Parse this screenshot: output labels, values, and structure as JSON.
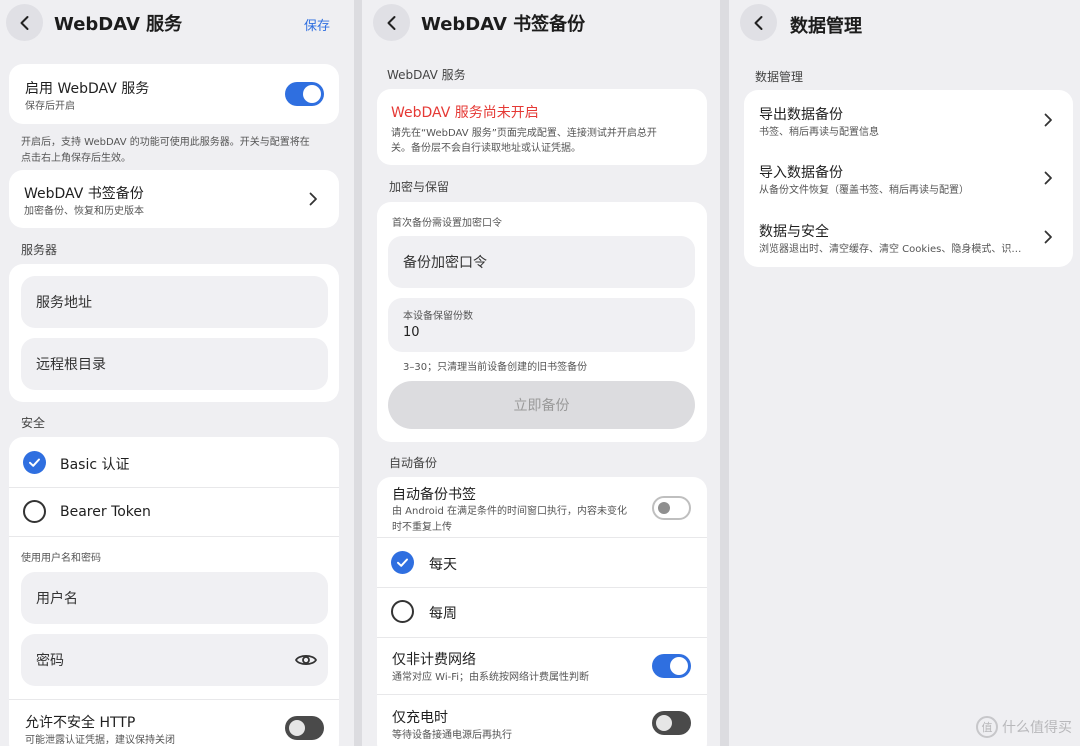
{
  "panel1": {
    "title": "WebDAV 服务",
    "save_label": "保存",
    "enable": {
      "title": "启用 WebDAV 服务",
      "sub": "保存后开启",
      "on": true
    },
    "enable_note_1": "开启后，支持 WebDAV 的功能可使用此服务器。开关与配置将在",
    "enable_note_2": "点击右上角保存后生效。",
    "bookmark_backup": {
      "title": "WebDAV 书签备份",
      "sub": "加密备份、恢复和历史版本"
    },
    "server_section": "服务器",
    "server_address_placeholder": "服务地址",
    "remote_root_placeholder": "远程根目录",
    "security_section": "安全",
    "auth_basic": "Basic 认证",
    "auth_bearer": "Bearer Token",
    "credentials_note": "使用用户名和密码",
    "username_placeholder": "用户名",
    "password_placeholder": "密码",
    "insecure_http": {
      "title": "允许不安全 HTTP",
      "sub": "可能泄露认证凭据，建议保持关闭",
      "on": false
    }
  },
  "panel2": {
    "title": "WebDAV 书签备份",
    "webdav_section": "WebDAV 服务",
    "warning_title": "WebDAV 服务尚未开启",
    "warning_body_1": "请先在“WebDAV 服务”页面完成配置、连接测试并开启总开",
    "warning_body_2": "关。备份层不会自行读取地址或认证凭据。",
    "encrypt_section": "加密与保留",
    "first_backup_note": "首次备份需设置加密口令",
    "passphrase_placeholder": "备份加密口令",
    "retention_label": "本设备保留份数",
    "retention_value": "10",
    "retention_note": "3–30；只清理当前设备创建的旧书签备份",
    "backup_now": "立即备份",
    "auto_section": "自动备份",
    "auto_backup": {
      "title": "自动备份书签",
      "sub_1": "由 Android 在满足条件的时间窗口执行，内容未变化",
      "sub_2": "时不重复上传",
      "on": false
    },
    "daily": "每天",
    "weekly": "每周",
    "unmetered": {
      "title": "仅非计费网络",
      "sub": "通常对应 Wi‑Fi；由系统按网络计费属性判断",
      "on": true
    },
    "charging": {
      "title": "仅充电时",
      "sub": "等待设备接通电源后再执行",
      "on": false
    }
  },
  "panel3": {
    "title": "数据管理",
    "section": "数据管理",
    "items": [
      {
        "title": "导出数据备份",
        "sub": "书签、稍后再读与配置信息"
      },
      {
        "title": "导入数据备份",
        "sub": "从备份文件恢复（覆盖书签、稍后再读与配置）"
      },
      {
        "title": "数据与安全",
        "sub": "浏览器退出时、清空缓存、清空 Cookies、隐身模式、识…"
      }
    ]
  },
  "watermark": "什么值得买",
  "watermark_logo": "值",
  "colors": {
    "accent": "#2f6fe0",
    "warning": "#e53935",
    "background": "#efeff2",
    "card": "#ffffff"
  }
}
